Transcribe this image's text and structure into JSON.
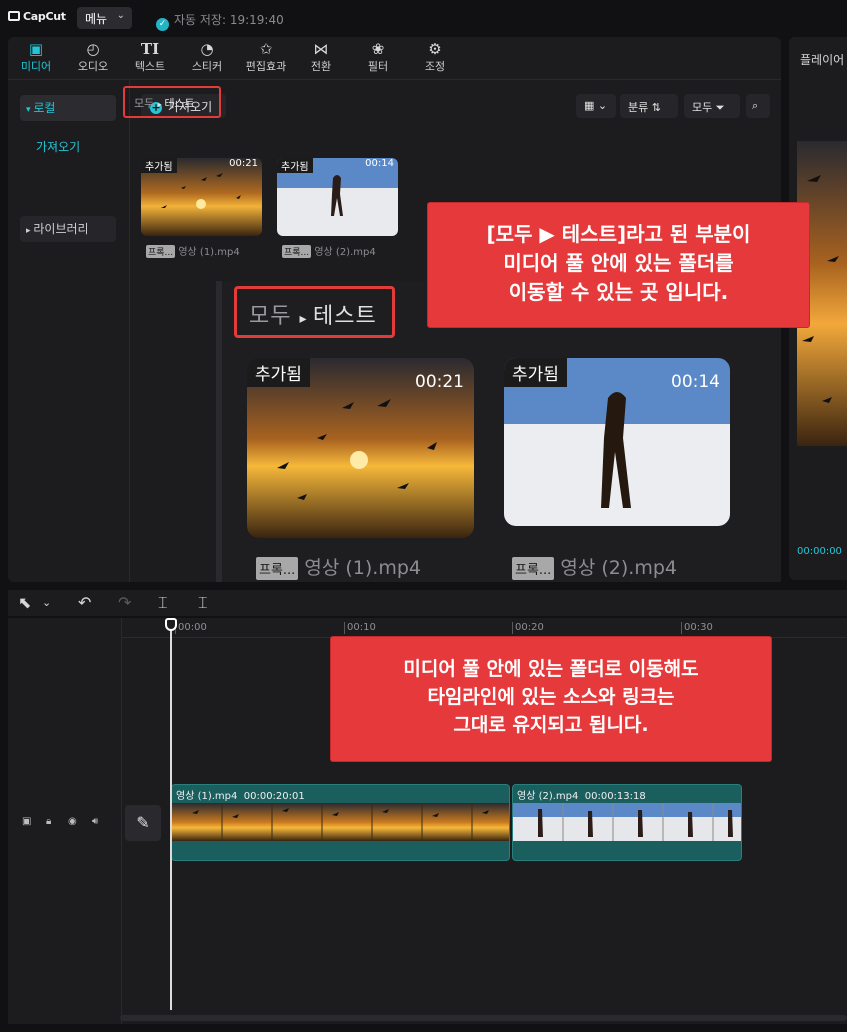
{
  "app": {
    "logo": "CapCut",
    "menu_label": "메뉴",
    "autosave": "자동 저장: 19:19:40"
  },
  "tabs": [
    {
      "label": "미디어",
      "icon": "media-icon",
      "active": true
    },
    {
      "label": "오디오",
      "icon": "audio-icon"
    },
    {
      "label": "텍스트",
      "icon": "text-icon"
    },
    {
      "label": "스티커",
      "icon": "sticker-icon"
    },
    {
      "label": "편집효과",
      "icon": "effects-icon"
    },
    {
      "label": "전환",
      "icon": "transition-icon"
    },
    {
      "label": "필터",
      "icon": "filter-icon"
    },
    {
      "label": "조정",
      "icon": "adjust-icon"
    }
  ],
  "sidebar": {
    "local": "로컬",
    "import": "가져오기",
    "library": "라이브러리"
  },
  "media_toolbar": {
    "import_btn": "가져오기",
    "sort_btn": "분류",
    "filter_btn": "모두"
  },
  "breadcrumb": {
    "root": "모두",
    "folder": "테스트"
  },
  "media_items": [
    {
      "badge": "추가됨",
      "duration": "00:21",
      "tag": "프록...",
      "name": "영상 (1).mp4"
    },
    {
      "badge": "추가됨",
      "duration": "00:14",
      "tag": "프록...",
      "name": "영상 (2).mp4"
    }
  ],
  "preview": {
    "title": "플레이어",
    "time": "00:00:00"
  },
  "timeline": {
    "ticks": [
      "00:00",
      "00:10",
      "00:20",
      "00:30"
    ],
    "clips": [
      {
        "name": "영상 (1).mp4",
        "duration": "00:00:20:01"
      },
      {
        "name": "영상 (2).mp4",
        "duration": "00:00:13:18"
      }
    ]
  },
  "callouts": {
    "top": [
      "[모두 ▶ 테스트]라고 된 부분이",
      "미디어 풀 안에 있는 폴더를",
      "이동할 수 있는 곳 입니다."
    ],
    "bottom": [
      "미디어 풀 안에 있는 폴더로 이동해도",
      "타임라인에 있는 소스와 링크는",
      "그대로 유지되고 됩니다."
    ]
  },
  "colors": {
    "accent": "#22c6d6",
    "callout": "#e6393c",
    "clip": "#1a5e5e"
  }
}
